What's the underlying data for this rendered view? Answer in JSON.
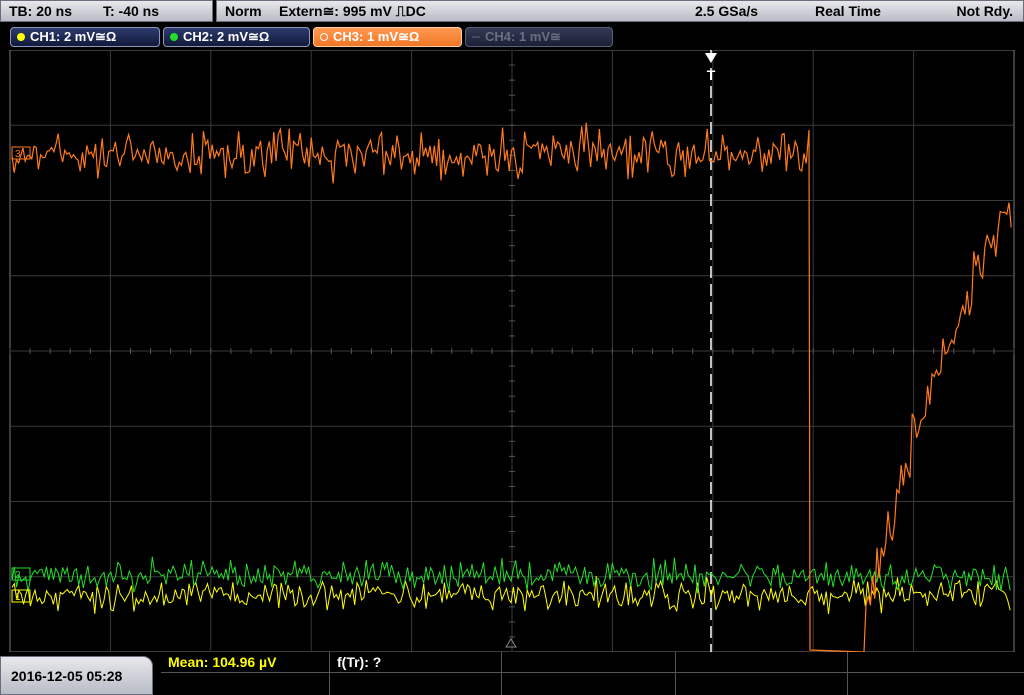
{
  "timebase": {
    "tb_label": "TB: 20 ns",
    "trigger_time_label": "T: -40 ns"
  },
  "trigger": {
    "mode": "Norm",
    "source": "Extern≅: 995 mV ⎍DC",
    "sample_rate": "2.5 GSa/s",
    "acquisition": "Real Time",
    "status": "Not Rdy."
  },
  "channels": [
    {
      "label": "CH1: 2 mV≅Ω",
      "color": "#ffff00",
      "active": true
    },
    {
      "label": "CH2: 2 mV≅Ω",
      "color": "#22e02a",
      "active": true
    },
    {
      "label": "CH3: 1 mV≅Ω",
      "color": "#ff7a1a",
      "active": true,
      "selected": true
    },
    {
      "label": "CH4: 1 mV≅",
      "color": "#6a6e80",
      "active": false
    }
  ],
  "trigger_marker": "T",
  "measurements": {
    "mean": "Mean: 104.96 µV",
    "rise_freq": "f(Tr): ?"
  },
  "datetime": "2016-12-05 05:28",
  "colors": {
    "grid": "#3a3a3a",
    "ch1": "#ffff00",
    "ch2": "#22e02a",
    "ch3": "#ff7a1a",
    "trigger_line": "#ffffff"
  }
}
